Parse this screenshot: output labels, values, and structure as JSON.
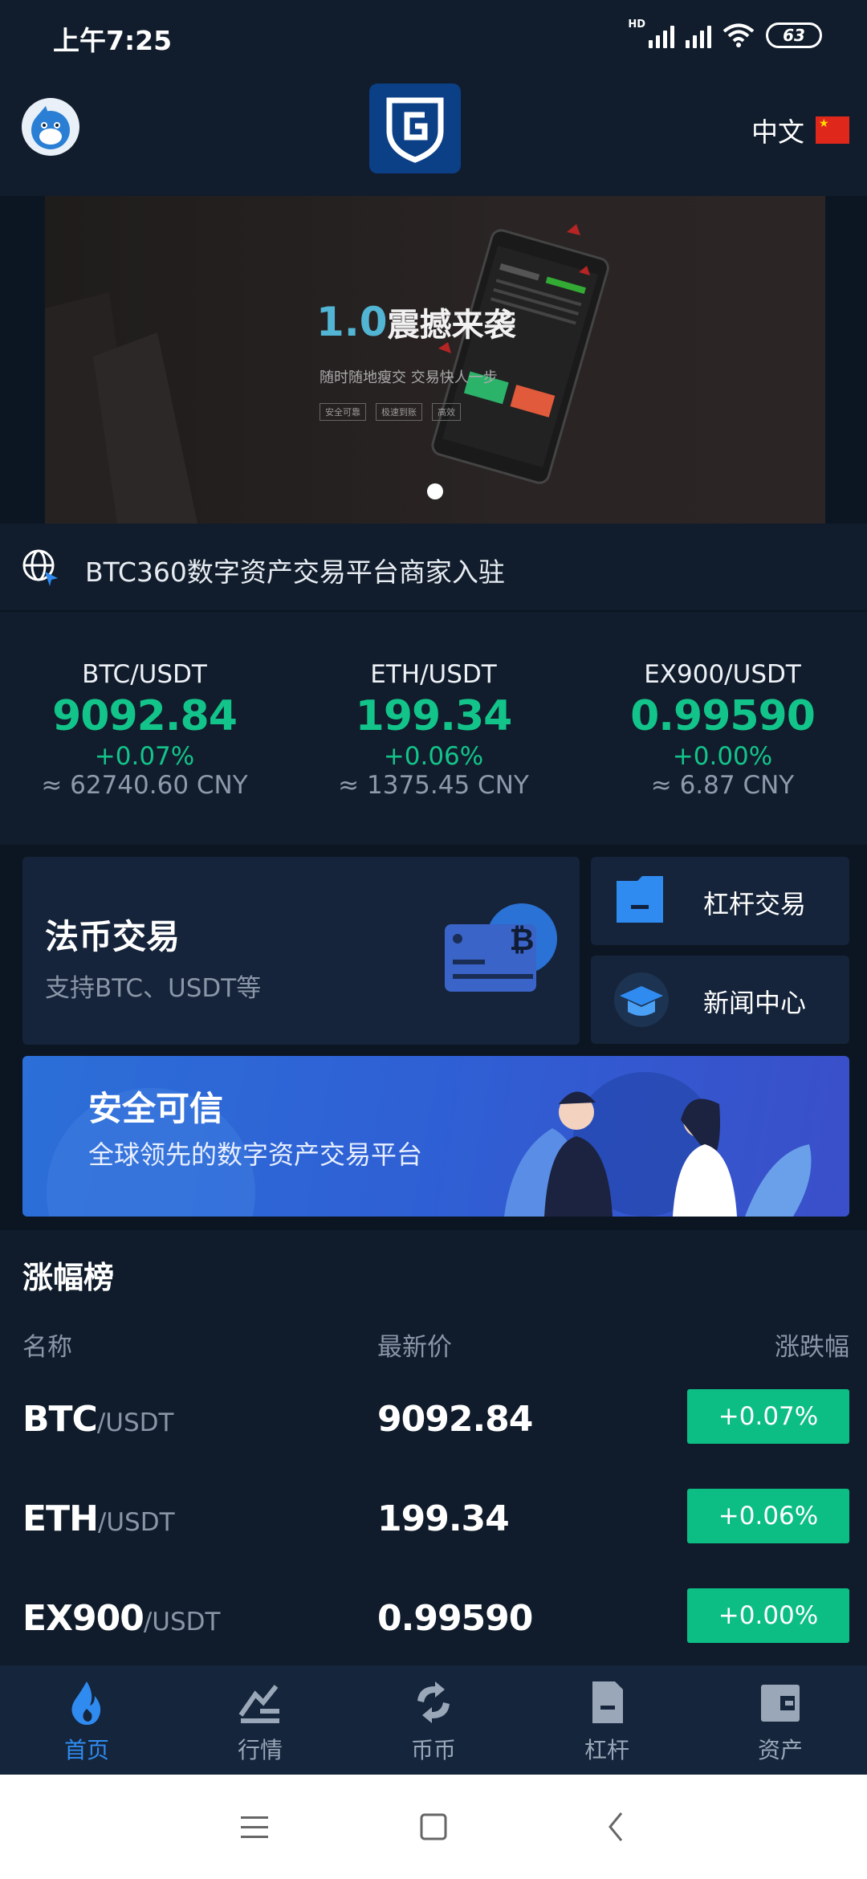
{
  "status_bar": {
    "time": "上午7:25",
    "network": "HD",
    "battery": "63"
  },
  "header": {
    "language": "中文"
  },
  "banner": {
    "title_num": "1.0",
    "title": "震撼来袭",
    "subtitle": "随时随地瘦交  交易快人一步",
    "tags": [
      "安全可靠",
      "极速到账",
      "高效"
    ]
  },
  "notice": {
    "text": "BTC360数字资产交易平台商家入驻"
  },
  "tickers": [
    {
      "pair": "BTC/USDT",
      "price": "9092.84",
      "change": "+0.07%",
      "cny": "≈ 62740.60 CNY"
    },
    {
      "pair": "ETH/USDT",
      "price": "199.34",
      "change": "+0.06%",
      "cny": "≈ 1375.45 CNY"
    },
    {
      "pair": "EX900/USDT",
      "price": "0.99590",
      "change": "+0.00%",
      "cny": "≈ 6.87 CNY"
    }
  ],
  "features": {
    "fiat_title": "法币交易",
    "fiat_sub": "支持BTC、USDT等",
    "leverage": "杠杆交易",
    "news": "新闻中心",
    "safe_title": "安全可信",
    "safe_sub": "全球领先的数字资产交易平台"
  },
  "gainers": {
    "title": "涨幅榜",
    "col_name": "名称",
    "col_price": "最新价",
    "col_change": "涨跌幅",
    "rows": [
      {
        "base": "BTC",
        "quote": "/USDT",
        "price": "9092.84",
        "change": "+0.07%"
      },
      {
        "base": "ETH",
        "quote": "/USDT",
        "price": "199.34",
        "change": "+0.06%"
      },
      {
        "base": "EX900",
        "quote": "/USDT",
        "price": "0.99590",
        "change": "+0.00%"
      }
    ]
  },
  "nav": [
    {
      "label": "首页",
      "icon": "flame-icon",
      "active": true
    },
    {
      "label": "行情",
      "icon": "market-icon"
    },
    {
      "label": "币币",
      "icon": "exchange-icon"
    },
    {
      "label": "杠杆",
      "icon": "document-icon"
    },
    {
      "label": "资产",
      "icon": "wallet-icon"
    }
  ],
  "colors": {
    "up": "#0cbe84",
    "accent": "#2f8bf0",
    "background": "#101c2b"
  }
}
